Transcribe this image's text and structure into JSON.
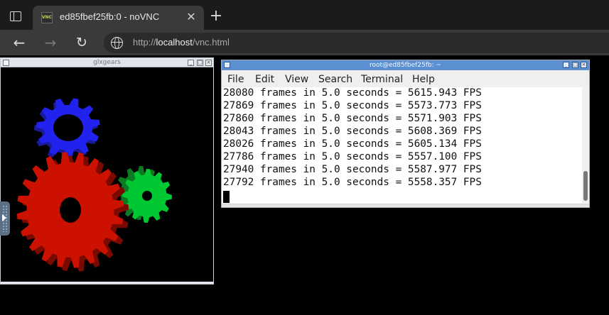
{
  "browser": {
    "tab_title": "ed85fbef25fb:0 - noVNC",
    "favicon_text": "VNC",
    "tab_close": "✕",
    "new_tab": "+",
    "url_prefix": "http://",
    "url_host": "localhost",
    "url_path": "/vnc.html",
    "icons": [
      "tab-strip-icon",
      "back-arrow-icon",
      "forward-arrow-icon",
      "reload-icon",
      "globe-icon"
    ]
  },
  "glxgears": {
    "title": "glxgears",
    "gear_colors": {
      "red": "#cc1100",
      "green": "#00c832",
      "blue": "#2222ee"
    }
  },
  "terminal": {
    "title": "root@ed85fbef25fb: ~",
    "menu": [
      "File",
      "Edit",
      "View",
      "Search",
      "Terminal",
      "Help"
    ],
    "lines": [
      "28080 frames in 5.0 seconds = 5615.943 FPS",
      "27869 frames in 5.0 seconds = 5573.773 FPS",
      "27860 frames in 5.0 seconds = 5571.903 FPS",
      "28043 frames in 5.0 seconds = 5608.369 FPS",
      "28026 frames in 5.0 seconds = 5605.134 FPS",
      "27786 frames in 5.0 seconds = 5557.100 FPS",
      "27940 frames in 5.0 seconds = 5587.977 FPS",
      "27792 frames in 5.0 seconds = 5558.357 FPS"
    ]
  }
}
